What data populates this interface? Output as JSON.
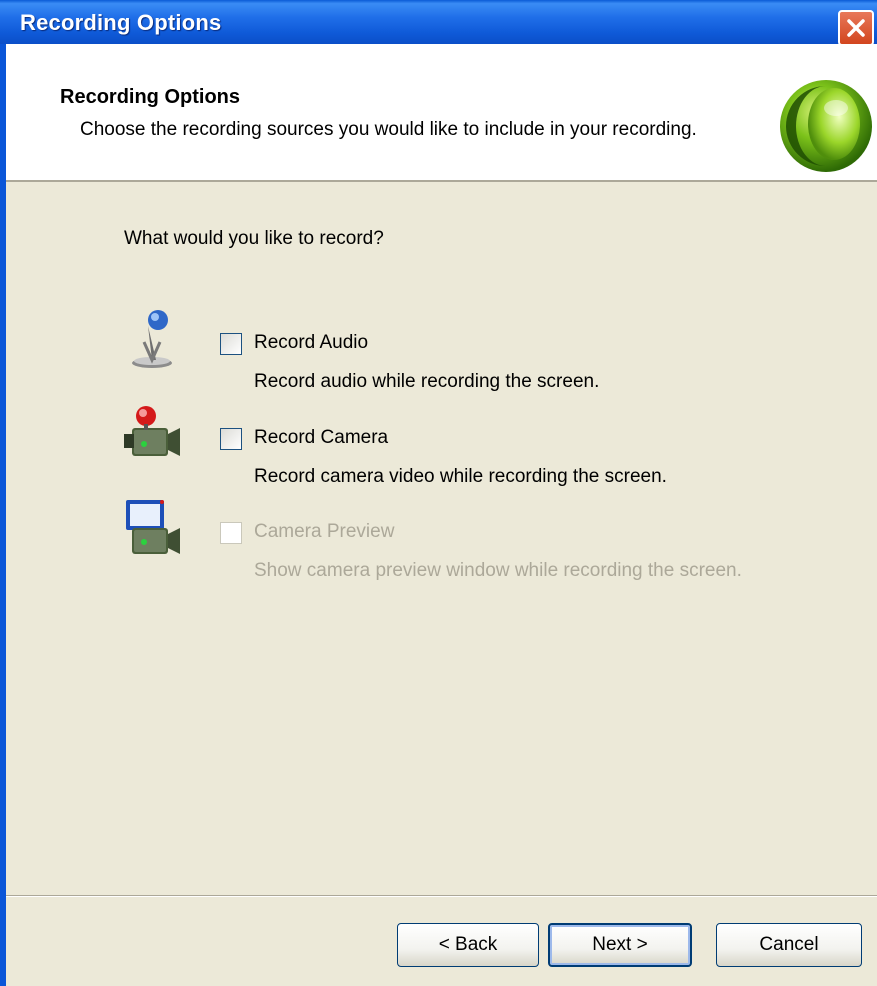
{
  "window": {
    "title": "Recording Options",
    "close_icon": "close-icon"
  },
  "header": {
    "title": "Recording Options",
    "subtitle": "Choose the recording sources you would like to include in your recording.",
    "logo_icon": "green-orb-logo-icon"
  },
  "content": {
    "question": "What would you like to record?",
    "options": [
      {
        "icon": "microphone-icon",
        "label": "Record Audio",
        "description": "Record audio while recording the screen.",
        "checked": false,
        "enabled": true
      },
      {
        "icon": "camera-icon",
        "label": "Record Camera",
        "description": "Record camera video while recording the screen.",
        "checked": false,
        "enabled": true
      },
      {
        "icon": "camera-preview-icon",
        "label": "Camera Preview",
        "description": "Show camera preview window while recording the screen.",
        "checked": false,
        "enabled": false
      }
    ]
  },
  "footer": {
    "back_label": "< Back",
    "next_label": "Next >",
    "cancel_label": "Cancel"
  },
  "colors": {
    "titlebar": "#0A5BD6",
    "dialog_background": "#ECE9D8",
    "disabled_text": "#ACA899",
    "close_button": "#D2451E"
  }
}
